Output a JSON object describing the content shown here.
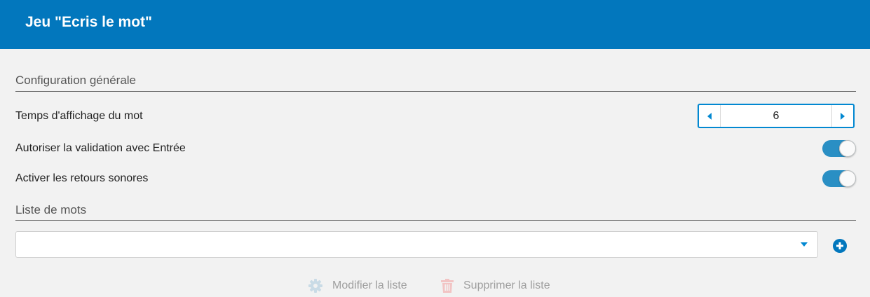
{
  "header": {
    "title": "Jeu \"Ecris le mot\""
  },
  "colors": {
    "header_bg": "#0277bd",
    "accent": "#0288d1",
    "toggle_on": "#2a8fc4",
    "disabled": "#9e9e9e"
  },
  "general": {
    "section_title": "Configuration générale",
    "display_time": {
      "label": "Temps d'affichage du mot",
      "value": "6"
    },
    "enter_validation": {
      "label": "Autoriser la validation avec Entrée",
      "enabled": true
    },
    "sound_feedback": {
      "label": "Activer les retours sonores",
      "enabled": true
    }
  },
  "words": {
    "section_title": "Liste de mots",
    "selected_list": "",
    "actions": {
      "edit_label": "Modifier la liste",
      "delete_label": "Supprimer la liste"
    }
  },
  "icons": {
    "edit": "gear-icon",
    "delete": "trash-icon",
    "add": "plus-circle-icon",
    "dropdown": "caret-down-icon"
  }
}
